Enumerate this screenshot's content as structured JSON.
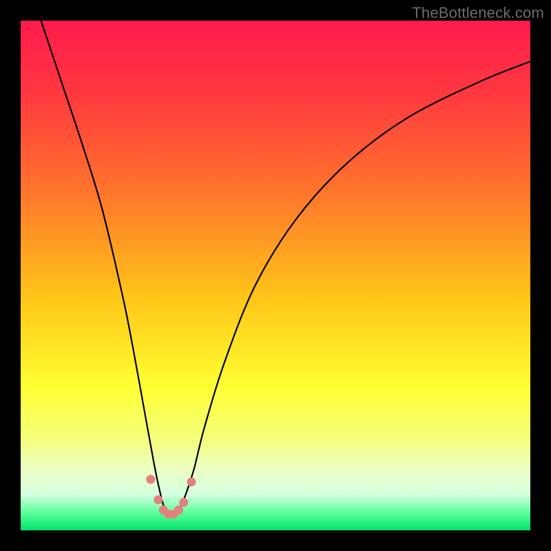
{
  "watermark": "TheBottleneck.com",
  "colors": {
    "gradient_stops": [
      {
        "offset": 0.0,
        "color": "#ff1a4d"
      },
      {
        "offset": 0.15,
        "color": "#ff3a3f"
      },
      {
        "offset": 0.35,
        "color": "#ff7a2a"
      },
      {
        "offset": 0.55,
        "color": "#ffc818"
      },
      {
        "offset": 0.72,
        "color": "#ffff33"
      },
      {
        "offset": 0.82,
        "color": "#f4ff7a"
      },
      {
        "offset": 0.88,
        "color": "#ecffc3"
      },
      {
        "offset": 0.93,
        "color": "#d4ffe0"
      },
      {
        "offset": 0.965,
        "color": "#5eff9a"
      },
      {
        "offset": 1.0,
        "color": "#00e36b"
      }
    ],
    "marker": "#e48080",
    "curve": "#000000",
    "frame": "#000000"
  },
  "chart_data": {
    "type": "line",
    "title": "",
    "xlabel": "",
    "ylabel": "",
    "xlim": [
      0,
      100
    ],
    "ylim": [
      0,
      100
    ],
    "series": [
      {
        "name": "bottleneck-curve",
        "x": [
          4,
          8,
          12,
          16,
          20,
          22,
          24,
          26,
          27,
          28,
          29,
          30,
          31,
          32,
          34,
          36,
          40,
          46,
          54,
          64,
          76,
          90,
          100
        ],
        "values": [
          100,
          88,
          76,
          63,
          46,
          36,
          25,
          14,
          9,
          5,
          3,
          3,
          4,
          6,
          12,
          20,
          33,
          48,
          61,
          72,
          81,
          88,
          92
        ]
      }
    ],
    "markers": {
      "name": "highlight-points",
      "x": [
        25.5,
        27.0,
        28.0,
        29.0,
        30.0,
        31.0,
        32.0,
        33.5
      ],
      "values": [
        10.0,
        6.0,
        4.0,
        3.2,
        3.2,
        4.0,
        5.5,
        9.5
      ],
      "radius_px": 6.5
    }
  }
}
